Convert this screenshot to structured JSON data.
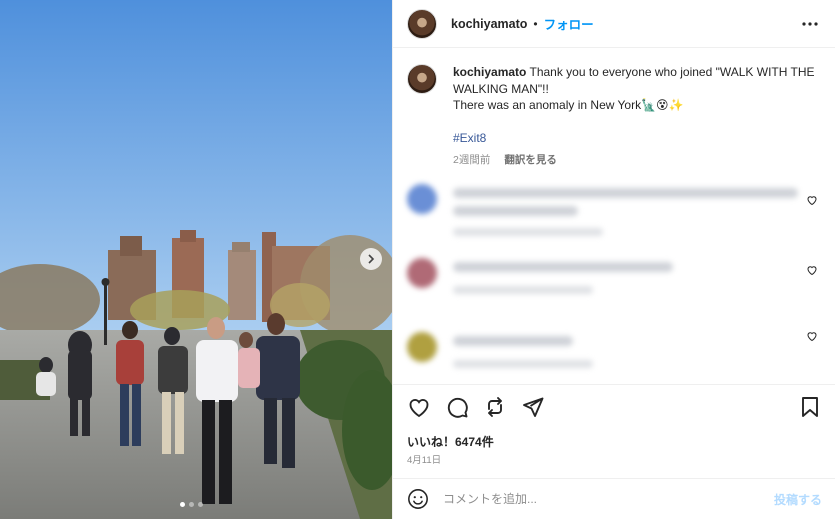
{
  "post": {
    "username": "kochiyamato",
    "separator": "•",
    "follow_label": "フォロー",
    "caption_line1": "Thank you to everyone who joined \"WALK WITH THE WALKING MAN\"!!",
    "caption_line2": "There was an anomaly in New York🗽😵✨",
    "hashtag": "#Exit8",
    "caption_time": "2週間前",
    "translate_label": "翻訳を見る",
    "likes": "いいね！6474件",
    "date": "4月11日"
  },
  "comment_box": {
    "placeholder": "コメントを追加...",
    "post_label": "投稿する"
  },
  "carousel": {
    "dot_count": 3,
    "active_index": 0
  },
  "icons": {
    "more": "more-horizontal-icon",
    "next": "chevron-right-icon",
    "like": "heart-icon",
    "comment": "comment-icon",
    "repost": "repost-icon",
    "share": "send-icon",
    "save": "bookmark-icon",
    "emoji": "emoji-icon"
  },
  "colors": {
    "link_blue": "#0095f6",
    "hashtag": "#385898",
    "post_disabled": "#b3dbff",
    "sky": "#6aa4e0"
  }
}
